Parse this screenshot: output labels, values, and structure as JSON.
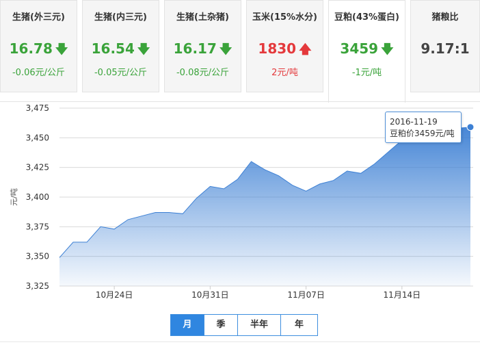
{
  "cards": [
    {
      "title": "生猪(外三元)",
      "price": "16.78",
      "trend": "down",
      "change": "-0.06元/公斤"
    },
    {
      "title": "生猪(内三元)",
      "price": "16.54",
      "trend": "down",
      "change": "-0.05元/公斤"
    },
    {
      "title": "生猪(土杂猪)",
      "price": "16.17",
      "trend": "down",
      "change": "-0.08元/公斤"
    },
    {
      "title": "玉米(15%水分)",
      "price": "1830",
      "trend": "up",
      "change": "2元/吨"
    },
    {
      "title": "豆粕(43%蛋白)",
      "price": "3459",
      "trend": "down",
      "change": "-1元/吨"
    },
    {
      "title": "猪粮比",
      "price": "9.17:1",
      "trend": "none",
      "change": ""
    }
  ],
  "colors": {
    "down": "#3aa33a",
    "up": "#e4393c",
    "line": "#3d80d4",
    "accent": "#2f86e0"
  },
  "tooltip": {
    "date": "2016-11-19",
    "text": "豆粕价3459元/吨"
  },
  "range_buttons": [
    {
      "label": "月",
      "active": true
    },
    {
      "label": "季",
      "active": false
    },
    {
      "label": "半年",
      "active": false
    },
    {
      "label": "年",
      "active": false
    }
  ],
  "chart_data": {
    "type": "area",
    "ylabel": "元/吨",
    "ylim": [
      3325,
      3475
    ],
    "yticks": [
      "3,325",
      "3,350",
      "3,375",
      "3,400",
      "3,425",
      "3,450",
      "3,475"
    ],
    "xticks": [
      {
        "label": "10月24日",
        "day": 4
      },
      {
        "label": "10月31日",
        "day": 11
      },
      {
        "label": "11月07日",
        "day": 18
      },
      {
        "label": "11月14日",
        "day": 25
      }
    ],
    "x_start": "2016-10-20",
    "x_end": "2016-11-19",
    "grid": true,
    "series": [
      {
        "values": [
          3349,
          3362,
          3362,
          3375,
          3373,
          3381,
          3384,
          3387,
          3387,
          3386,
          3399,
          3409,
          3407,
          3415,
          3430,
          3423,
          3418,
          3410,
          3405,
          3411,
          3414,
          3422,
          3420,
          3428,
          3438,
          3448,
          3452,
          3455,
          3457,
          3458,
          3459
        ]
      }
    ]
  }
}
